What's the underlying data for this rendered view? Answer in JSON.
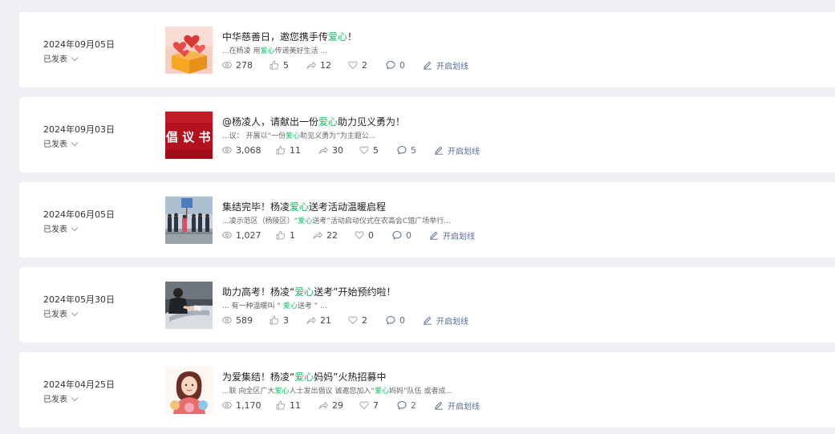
{
  "articles": [
    {
      "date": "2024年09月05日",
      "status": "已发表",
      "title": [
        "中华慈善日，邀您携手传",
        "爱心",
        "！"
      ],
      "excerpt": [
        "...在杨凌 用",
        "爱心",
        "传递美好生活 ..."
      ],
      "views": "278",
      "likes": "5",
      "shares": "12",
      "favorites": "2",
      "comments": "0",
      "action": "开启划线",
      "thumb": "hearts-box"
    },
    {
      "date": "2024年09月03日",
      "status": "已发表",
      "title": [
        "@杨凌人，请献出一份",
        "爱心",
        "助力见义勇为！"
      ],
      "excerpt": [
        "...议： 开展以“一份",
        "爱心",
        "助见义勇为”为主题公..."
      ],
      "views": "3,068",
      "likes": "11",
      "shares": "30",
      "favorites": "5",
      "comments": "5",
      "action": "开启划线",
      "thumb": "proposal",
      "thumb_text": "倡 议 书"
    },
    {
      "date": "2024年06月05日",
      "status": "已发表",
      "title": [
        "集结完毕！杨凌",
        "爱心",
        "送考活动温暖启程"
      ],
      "excerpt": [
        "...凌示范区（杨陵区）“",
        "爱心",
        "送考”活动启动仪式在农高会C馆广场举行..."
      ],
      "views": "1,027",
      "likes": "1",
      "shares": "22",
      "favorites": "0",
      "comments": "0",
      "action": "开启划线",
      "thumb": "crowd-photo"
    },
    {
      "date": "2024年05月30日",
      "status": "已发表",
      "title": [
        "助力高考！杨凌“",
        "爱心",
        "送考”开始预约啦！"
      ],
      "excerpt": [
        "... 有一种温暖叫 “ ",
        "爱心",
        "送考 ” ..."
      ],
      "views": "589",
      "likes": "3",
      "shares": "21",
      "favorites": "2",
      "comments": "0",
      "action": "开启划线",
      "thumb": "car-photo"
    },
    {
      "date": "2024年04月25日",
      "status": "已发表",
      "title": [
        "为爱集结！杨凌“",
        "爱心",
        "妈妈”火热招募中"
      ],
      "excerpt": [
        "...联 向全区广大",
        "爱心",
        "人士发出倡议 诚邀您加入“",
        "爱心",
        "妈妈”队伍 或者成..."
      ],
      "views": "1,170",
      "likes": "11",
      "shares": "29",
      "favorites": "7",
      "comments": "2",
      "action": "开启划线",
      "thumb": "mother-illustration"
    }
  ],
  "colors": {
    "highlight": "#07c160",
    "link": "#576b95",
    "page_bg": "#eef0f4"
  }
}
